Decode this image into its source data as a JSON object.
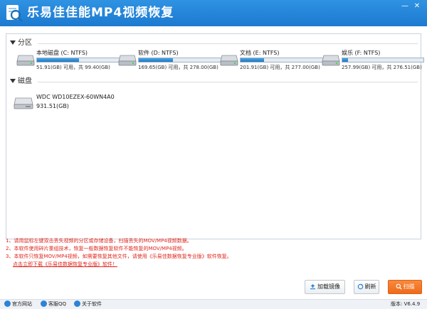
{
  "window": {
    "title": "乐易佳佳能MP4视频恢复",
    "minimize_glyph": "—",
    "close_glyph": "✕"
  },
  "partitions": {
    "title": "分区",
    "items": [
      {
        "name": "本地磁盘 (C: NTFS)",
        "info": "51.91(GB) 可用，共 99.40(GB)",
        "used_fraction": 0.48
      },
      {
        "name": "软件 (D: NTFS)",
        "info": "169.65(GB) 可用，共 278.00(GB)",
        "used_fraction": 0.39
      },
      {
        "name": "文档 (E: NTFS)",
        "info": "201.91(GB) 可用，共 277.00(GB)",
        "used_fraction": 0.27
      },
      {
        "name": "娱乐 (F: NTFS)",
        "info": "257.99(GB) 可用，共 276.51(GB)",
        "used_fraction": 0.07
      }
    ]
  },
  "disks": {
    "title": "磁盘",
    "items": [
      {
        "name": "WDC WD10EZEX-60WN4A0",
        "size": "931.51(GB)"
      }
    ]
  },
  "notes": {
    "line1": "1、请用鼠标左键双击丢失视频的分区或存储设备，扫描丢失的MOV/MP4视频数据。",
    "line2": "2、本软件使用碎片重组技术，恢复一般数据恢复软件不能恢复的MOV/MP4视频。",
    "line3": "3、本软件只恢复MOV/MP4视频，如需要恢复其他文件，请使用《乐易佳数据恢复专业版》软件恢复。",
    "link": "点击立即下载《乐易佳数据恢复专业版》软件！"
  },
  "buttons": {
    "mount": "加载镜像",
    "refresh": "刷新",
    "scan": "扫描"
  },
  "statusbar": {
    "website": "官方网站",
    "qq": "客服QQ",
    "about": "关于软件",
    "version": "版本: V6.4.9"
  },
  "colors": {
    "titlebar": "#1c7ad0",
    "accent": "#2b84d6",
    "scan_button": "#ef6a1b",
    "note_text": "#e0251b"
  }
}
